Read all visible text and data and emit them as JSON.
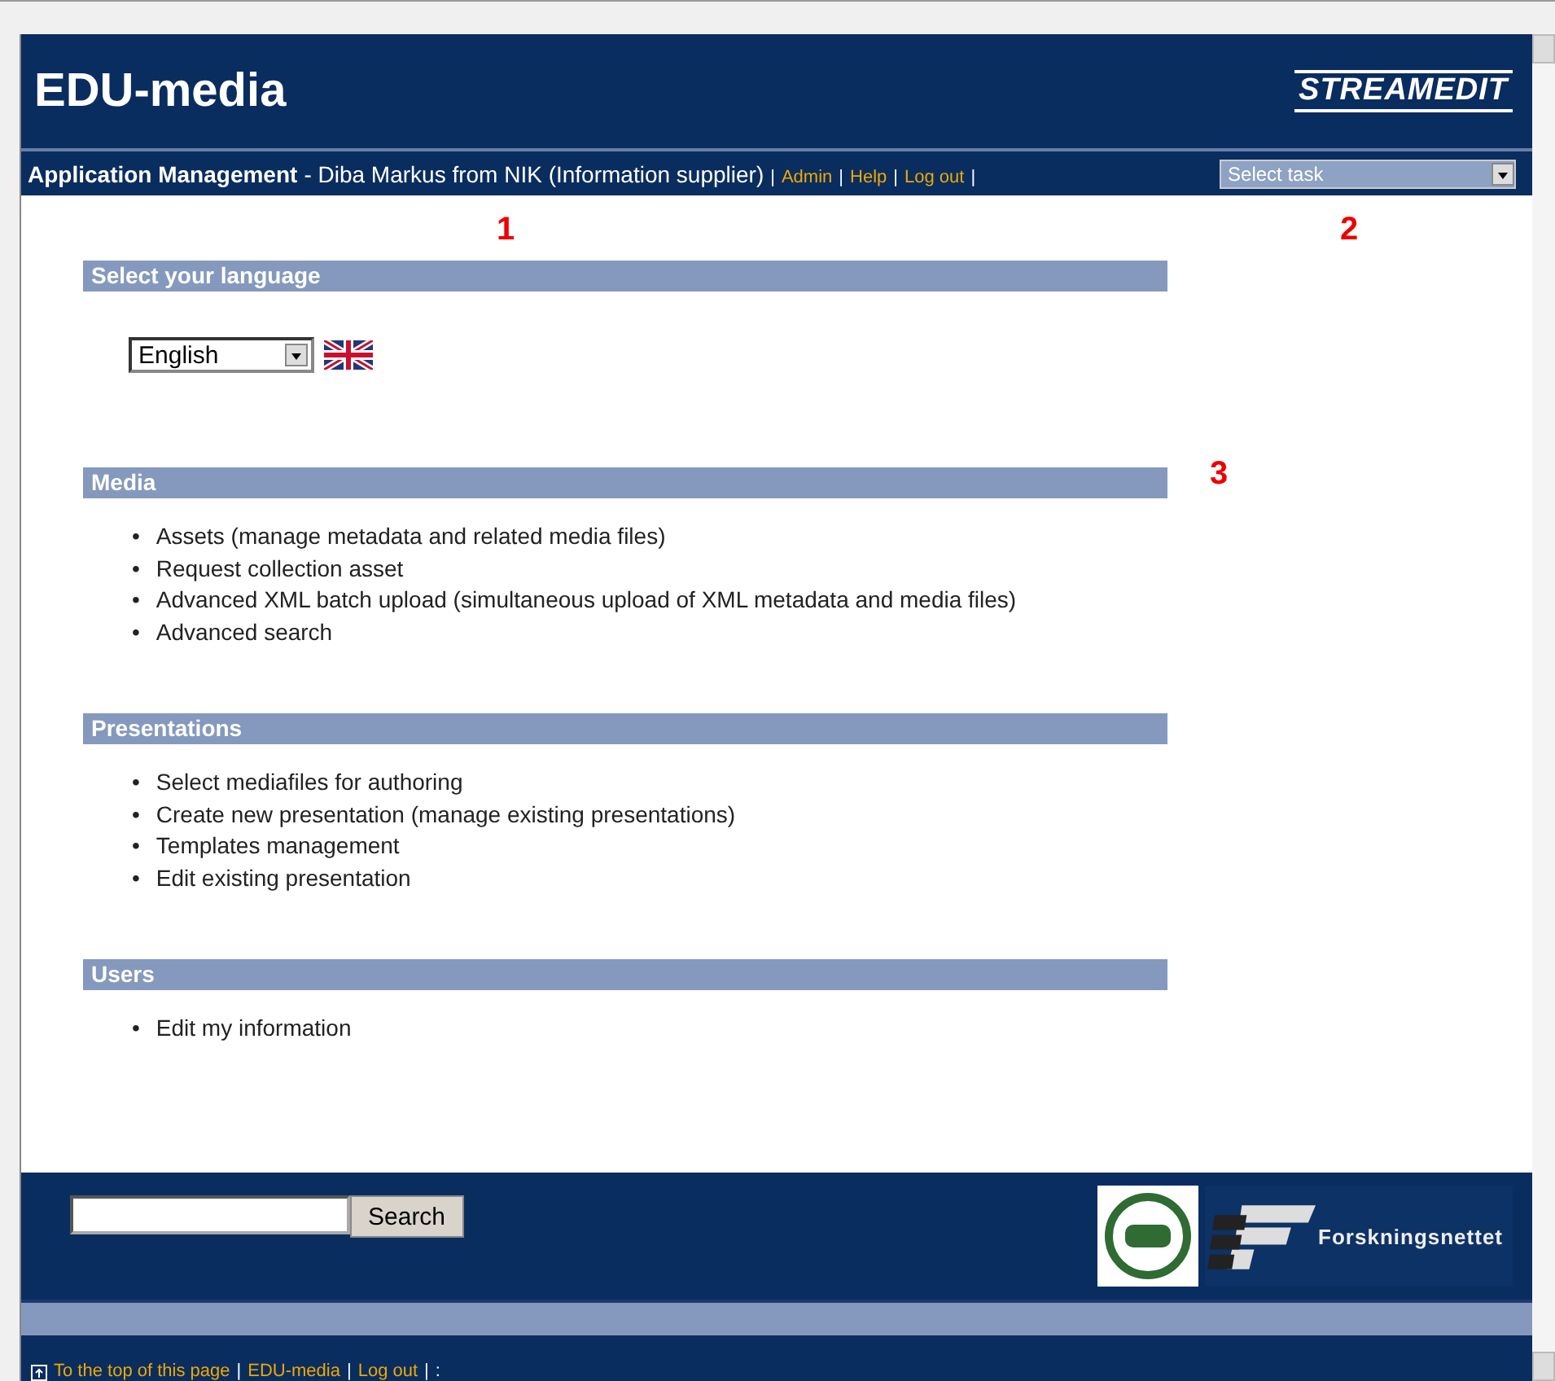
{
  "header": {
    "title": "EDU-media",
    "logo": "STREAMEDIT"
  },
  "subheader": {
    "app": "Application Management",
    "user": "- Diba Markus from NIK (Information supplier)",
    "links": [
      "Admin",
      "Help",
      "Log out"
    ],
    "separator": "|",
    "task_select": {
      "value": "Select task"
    }
  },
  "annotations": [
    "1",
    "2",
    "3"
  ],
  "sections": [
    {
      "title": "Select your language",
      "kind": "language",
      "language": {
        "value": "English"
      }
    },
    {
      "title": "Media",
      "kind": "list",
      "bullet": "•",
      "items": [
        "Assets (manage metadata and related media files)",
        "Request collection asset",
        "Advanced XML batch upload (simultaneous upload of XML metadata and media files)",
        "Advanced search"
      ]
    },
    {
      "title": "Presentations",
      "kind": "list",
      "bullet": "•",
      "items": [
        "Select mediafiles for authoring",
        "Create new presentation (manage existing presentations)",
        "Templates management",
        "Edit existing presentation"
      ]
    },
    {
      "title": "Users",
      "kind": "list",
      "bullet": "•",
      "items": [
        "Edit my information"
      ]
    }
  ],
  "footer": {
    "search_button": "Search",
    "partner_logo": "Forskningsnettet",
    "links": [
      "To the top of this page",
      "EDU-media",
      "Log out"
    ],
    "separator": "|",
    "trailing": ":"
  }
}
